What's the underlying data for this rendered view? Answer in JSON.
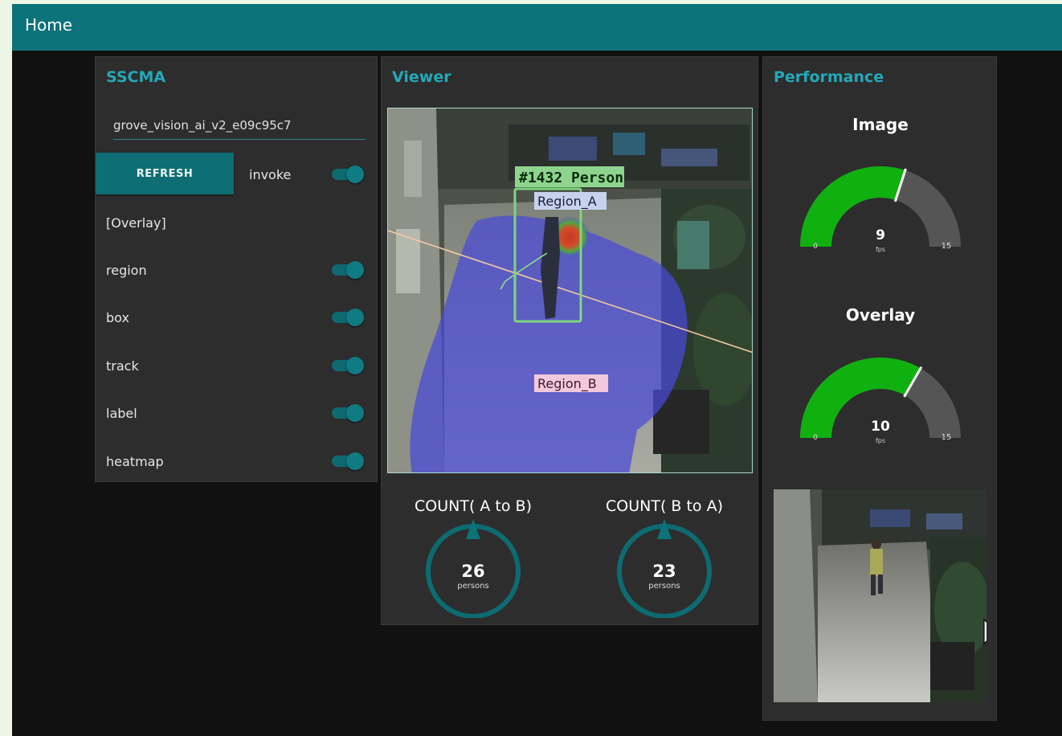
{
  "header": {
    "title": "Home"
  },
  "sscma": {
    "title": "SSCMA",
    "device_value": "grove_vision_ai_v2_e09c95c7",
    "refresh_label": "REFRESH",
    "invoke_label": "invoke",
    "overlay_heading": "[Overlay]",
    "toggles": [
      {
        "label": "region",
        "on": true
      },
      {
        "label": "box",
        "on": true
      },
      {
        "label": "track",
        "on": true
      },
      {
        "label": "label",
        "on": true
      },
      {
        "label": "heatmap",
        "on": true
      }
    ]
  },
  "viewer": {
    "title": "Viewer",
    "detection_label": "#1432 Person",
    "region_a_label": "Region_A",
    "region_b_label": "Region_B",
    "count_a_to_b": {
      "title": "COUNT( A to B)",
      "value": "26",
      "unit": "persons"
    },
    "count_b_to_a": {
      "title": "COUNT( B to A)",
      "value": "23",
      "unit": "persons"
    }
  },
  "performance": {
    "title": "Performance",
    "image_gauge": {
      "title": "Image",
      "value": 9,
      "min": 0,
      "max": 15,
      "unit": "fps",
      "min_label": "0",
      "max_label": "15"
    },
    "overlay_gauge": {
      "title": "Overlay",
      "value": 10,
      "min": 0,
      "max": 15,
      "unit": "fps",
      "min_label": "0",
      "max_label": "15"
    }
  },
  "colors": {
    "accent": "#0d737a",
    "title_cyan": "#23a9b8",
    "gauge_fill": "#10b010",
    "gauge_rest": "#555555",
    "panel_bg": "#2d2d2d"
  }
}
